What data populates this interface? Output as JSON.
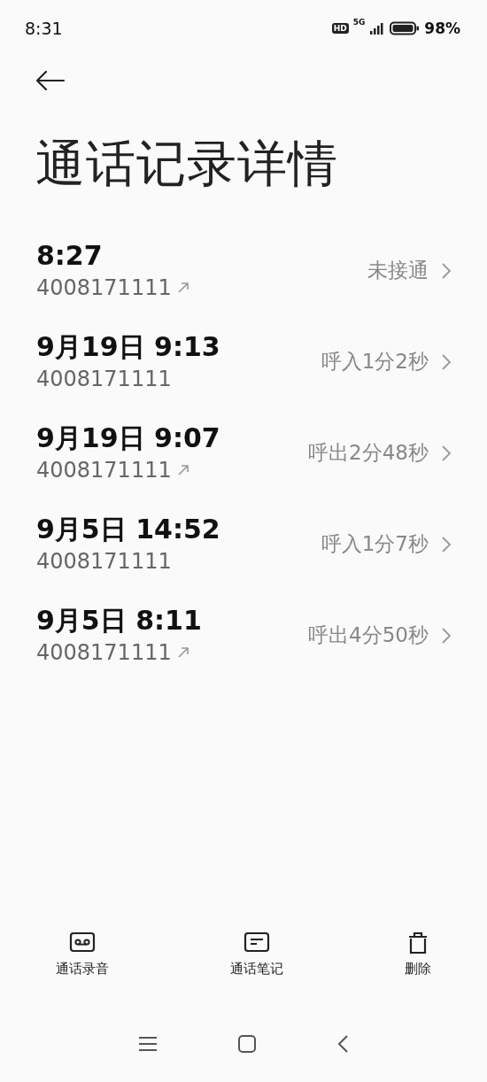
{
  "status_bar": {
    "time": "8:31",
    "hd": "HD",
    "network": "5G",
    "battery": "98%"
  },
  "title": "通话记录详情",
  "calls": [
    {
      "time": "8:27",
      "number": "4008171111",
      "outgoing": true,
      "result": "未接通"
    },
    {
      "time": "9月19日 9:13",
      "number": "4008171111",
      "outgoing": false,
      "result": "呼入1分2秒"
    },
    {
      "time": "9月19日 9:07",
      "number": "4008171111",
      "outgoing": true,
      "result": "呼出2分48秒"
    },
    {
      "time": "9月5日 14:52",
      "number": "4008171111",
      "outgoing": false,
      "result": "呼入1分7秒"
    },
    {
      "time": "9月5日 8:11",
      "number": "4008171111",
      "outgoing": true,
      "result": "呼出4分50秒"
    }
  ],
  "actions": [
    {
      "kind": "recording",
      "label": "通话录音"
    },
    {
      "kind": "notes",
      "label": "通话笔记"
    },
    {
      "kind": "delete",
      "label": "删除"
    }
  ]
}
